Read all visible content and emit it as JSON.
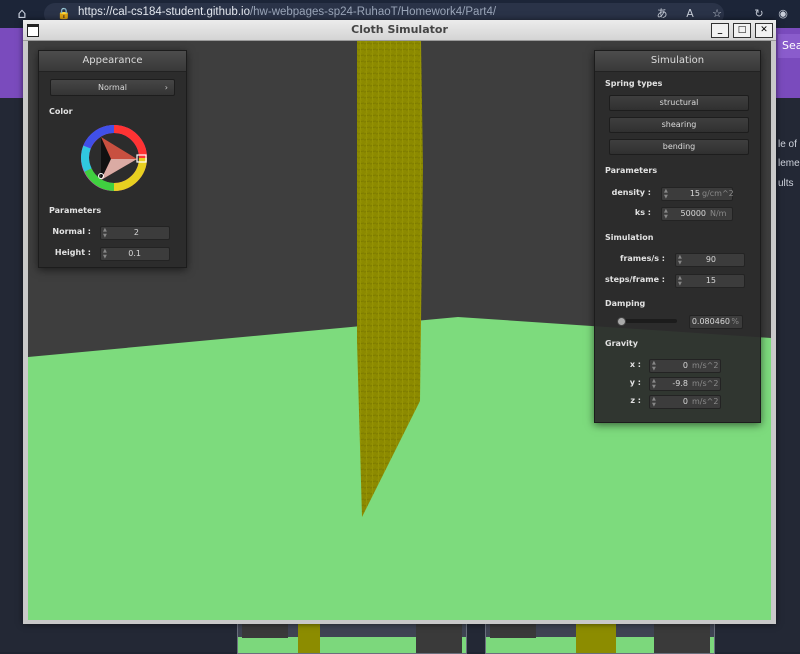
{
  "browser": {
    "url_host": "https://cal-cs184-student.github.io",
    "url_path": "/hw-webpages-sp24-RuhaoT/Homework4/Part4/",
    "icons": [
      "home-icon",
      "lock-icon",
      "translate-icon",
      "read-aloud-icon",
      "favorite-icon",
      "refresh-icon",
      "profile-icon"
    ]
  },
  "page_behind": {
    "search_label": "Sea",
    "side_snippets": [
      "le of c",
      "leme",
      "ults"
    ]
  },
  "window": {
    "title": "Cloth Simulator",
    "buttons": {
      "minimize": "_",
      "maximize": "□",
      "close": "✕"
    }
  },
  "appearance": {
    "title": "Appearance",
    "shader": "Normal",
    "color_label": "Color",
    "params_label": "Parameters",
    "normal_label": "Normal :",
    "normal_value": "2",
    "height_label": "Height :",
    "height_value": "0.1"
  },
  "simulation": {
    "title": "Simulation",
    "spring_types_label": "Spring types",
    "springs": [
      "structural",
      "shearing",
      "bending"
    ],
    "params_label": "Parameters",
    "density_label": "density :",
    "density_value": "15",
    "density_unit": "g/cm^2",
    "ks_label": "ks :",
    "ks_value": "50000",
    "ks_unit": "N/m",
    "sim_label": "Simulation",
    "fps_label": "frames/s :",
    "fps_value": "90",
    "steps_label": "steps/frame :",
    "steps_value": "15",
    "damping_label": "Damping",
    "damping_value": "0.080460",
    "damping_unit": "%",
    "damping_level": 0.0,
    "gravity_label": "Gravity",
    "gx_label": "x :",
    "gx_value": "0",
    "gy_label": "y :",
    "gy_value": "-9.8",
    "gz_label": "z :",
    "gz_value": "0",
    "gravity_unit": "m/s^2"
  },
  "colors": {
    "floor": "#7ddb7d",
    "cloth": "#8c8a00",
    "background": "#3e3e3e"
  }
}
